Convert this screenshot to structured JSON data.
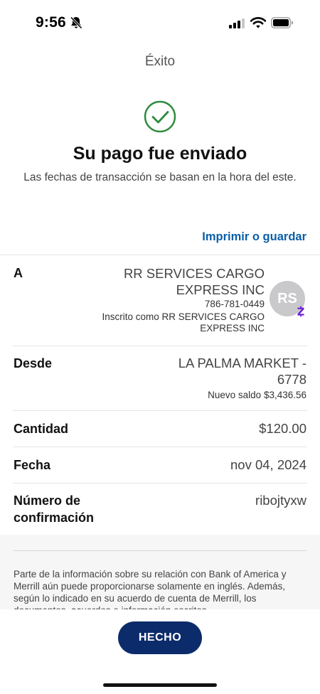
{
  "status_bar": {
    "time": "9:56"
  },
  "nav": {
    "title": "Éxito"
  },
  "confirmation": {
    "headline": "Su pago fue enviado",
    "subtitle": "Las fechas de transacción se basan en la hora del este."
  },
  "print_link": "Imprimir o guardar",
  "details": {
    "to": {
      "label": "A",
      "name": "RR SERVICES CARGO EXPRESS INC",
      "phone": "786-781-0449",
      "enrolled_as": "Inscrito como RR SERVICES CARGO EXPRESS INC",
      "avatar_initials": "RS"
    },
    "from": {
      "label": "Desde",
      "account": "LA PALMA MARKET - 6778",
      "new_balance": "Nuevo saldo $3,436.56"
    },
    "amount": {
      "label": "Cantidad",
      "value": "$120.00"
    },
    "date": {
      "label": "Fecha",
      "value": "nov 04, 2024"
    },
    "confirmation_number": {
      "label": "Número de confirmación",
      "value": "ribojtyxw"
    }
  },
  "disclaimer": "Parte de la información sobre su relación con Bank of America y Merrill aún puede proporcionarse solamente en inglés. Además, según lo indicado en su acuerdo de cuenta de Merrill, los documentos, acuerdos e información escritos",
  "done_button": "HECHO",
  "colors": {
    "accent": "#0a5fa8",
    "button": "#0c2b6b",
    "success": "#2e8b3e",
    "zelle": "#6d1ed4"
  }
}
